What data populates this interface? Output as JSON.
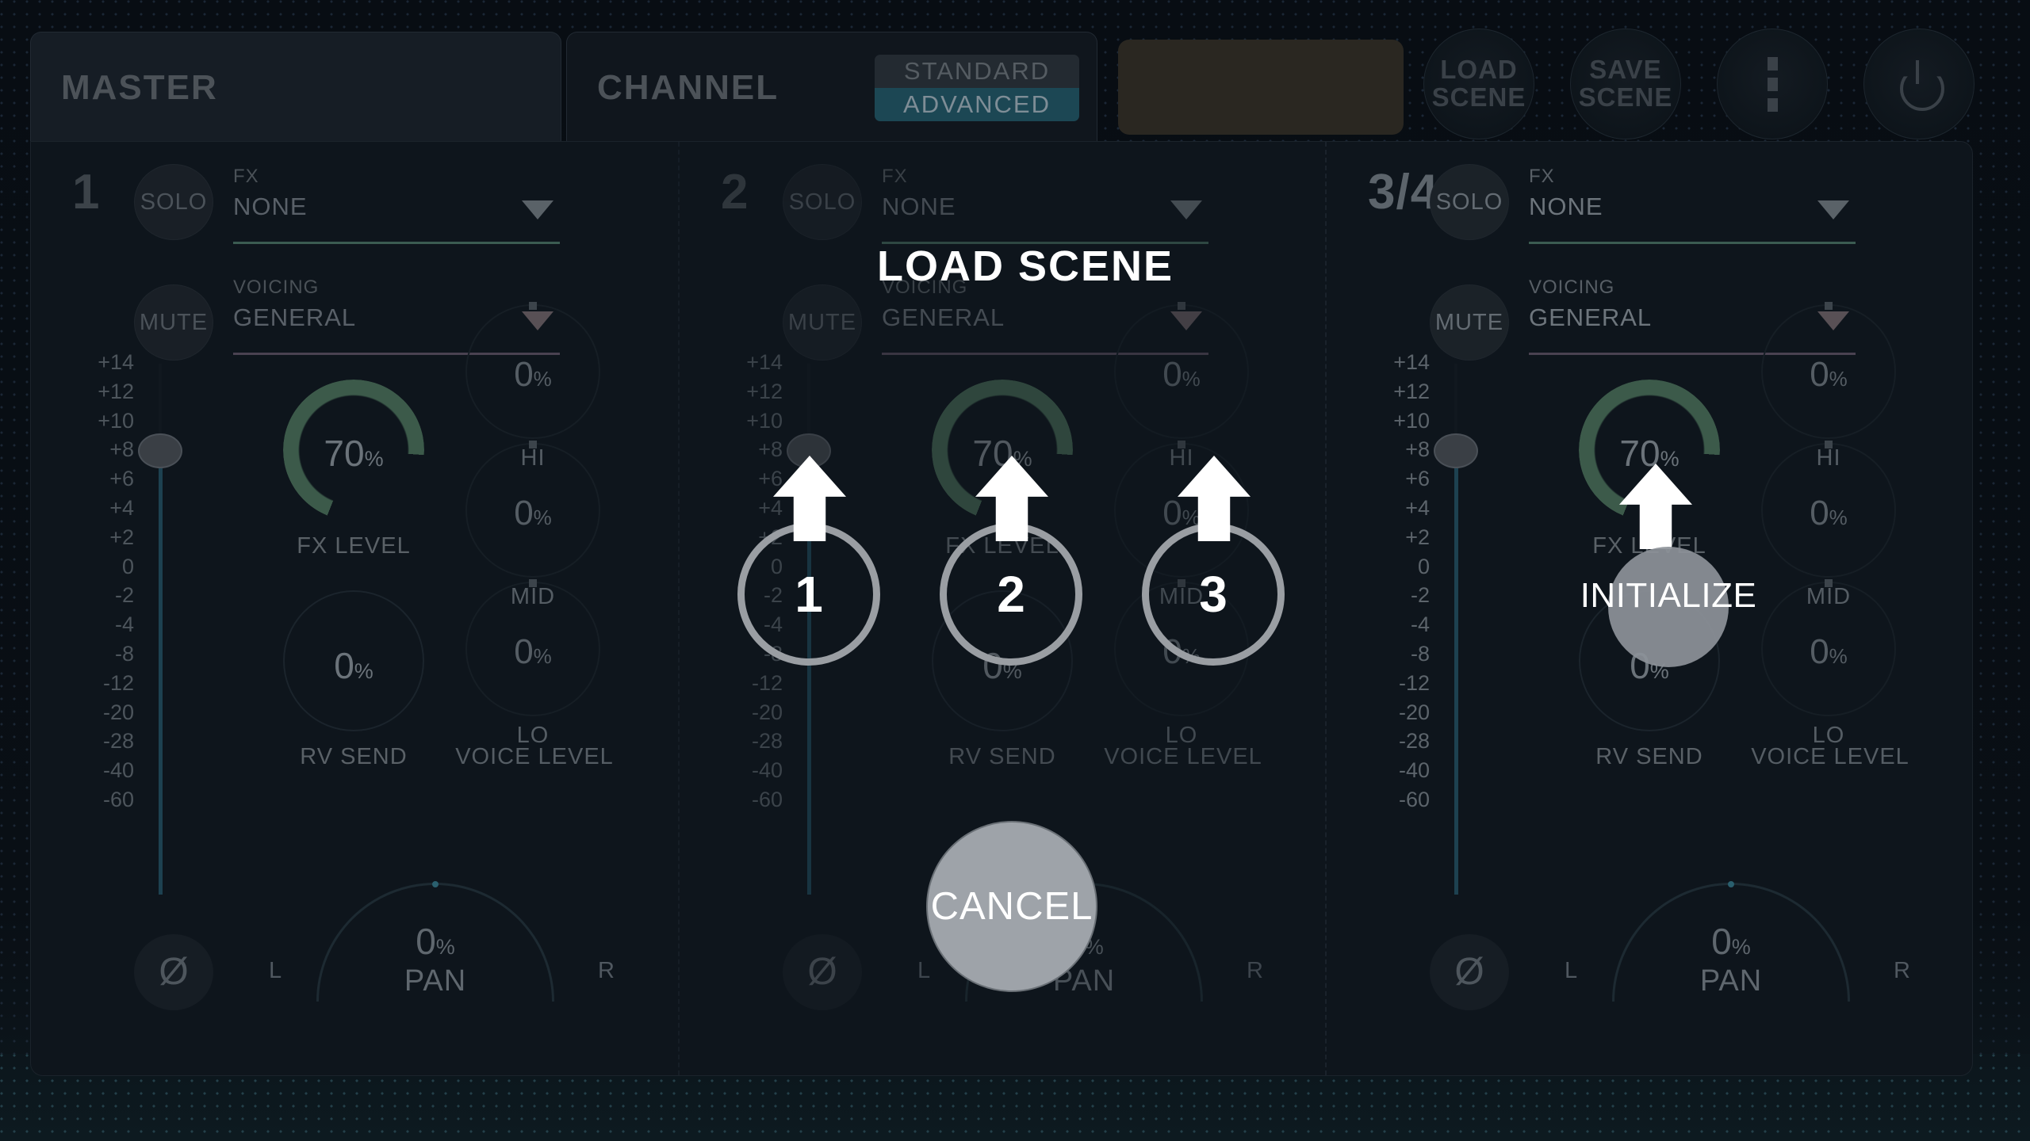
{
  "tabs": [
    {
      "label": "MASTER",
      "active": true
    },
    {
      "label": "CHANNEL",
      "active": false
    }
  ],
  "mode_switch": {
    "standard_label": "STANDARD",
    "advanced_label": "ADVANCED",
    "selected": "ADVANCED",
    "selected_color": "#1c4754"
  },
  "header_buttons": [
    {
      "name": "load-scene",
      "line1": "LOAD",
      "line2": "SCENE"
    },
    {
      "name": "save-scene",
      "line1": "SAVE",
      "line2": "SCENE"
    },
    {
      "name": "more-menu",
      "icon": "vertical-dots-icon"
    },
    {
      "name": "power",
      "icon": "power-icon"
    }
  ],
  "channels": [
    {
      "number": "1",
      "solo": "SOLO",
      "mute": "MUTE",
      "fx": {
        "caption": "FX",
        "value": "NONE"
      },
      "voicing": {
        "caption": "VOICING",
        "value": "GENERAL"
      },
      "fx_level": {
        "value": "70",
        "unit": "%",
        "label": "FX LEVEL"
      },
      "rv_send": {
        "value": "0",
        "unit": "%",
        "label": "RV SEND"
      },
      "eq": [
        {
          "value": "0",
          "unit": "%",
          "label": "HI"
        },
        {
          "value": "0",
          "unit": "%",
          "label": "MID"
        },
        {
          "value": "0",
          "unit": "%",
          "label": "LO"
        }
      ],
      "voice_level_label": "VOICE LEVEL",
      "phase_icon": "phase-invert-icon",
      "pan": {
        "value": "0",
        "unit": "%",
        "label": "PAN",
        "left": "L",
        "right": "R"
      }
    },
    {
      "number": "2",
      "solo": "SOLO",
      "mute": "MUTE",
      "fx": {
        "caption": "FX",
        "value": "NONE"
      },
      "voicing": {
        "caption": "VOICING",
        "value": "GENERAL"
      },
      "fx_level": {
        "value": "70",
        "unit": "%",
        "label": "FX LEVEL"
      },
      "rv_send": {
        "value": "0",
        "unit": "%",
        "label": "RV SEND"
      },
      "eq": [
        {
          "value": "0",
          "unit": "%",
          "label": "HI"
        },
        {
          "value": "0",
          "unit": "%",
          "label": "MID"
        },
        {
          "value": "0",
          "unit": "%",
          "label": "LO"
        }
      ],
      "voice_level_label": "VOICE LEVEL",
      "phase_icon": "phase-invert-icon",
      "pan": {
        "value": "0",
        "unit": "%",
        "label": "PAN",
        "left": "L",
        "right": "R"
      }
    },
    {
      "number": "3/4",
      "solo": "SOLO",
      "mute": "MUTE",
      "fx": {
        "caption": "FX",
        "value": "NONE"
      },
      "voicing": {
        "caption": "VOICING",
        "value": "GENERAL"
      },
      "fx_level": {
        "value": "70",
        "unit": "%",
        "label": "FX LEVEL"
      },
      "rv_send": {
        "value": "0",
        "unit": "%",
        "label": "RV SEND"
      },
      "eq": [
        {
          "value": "0",
          "unit": "%",
          "label": "HI"
        },
        {
          "value": "0",
          "unit": "%",
          "label": "MID"
        },
        {
          "value": "0",
          "unit": "%",
          "label": "LO"
        }
      ],
      "voice_level_label": "VOICE LEVEL",
      "phase_icon": "phase-invert-icon",
      "pan": {
        "value": "0",
        "unit": "%",
        "label": "PAN",
        "left": "L",
        "right": "R"
      }
    }
  ],
  "db_scale": [
    "+14",
    "+12",
    "+10",
    "+8",
    "+6",
    "+4",
    "+2",
    "0",
    "-2",
    "-4",
    "-8",
    "-12",
    "-20",
    "-28",
    "-40",
    "-60"
  ],
  "dialog": {
    "title": "LOAD SCENE",
    "slots": [
      {
        "label": "1",
        "arrow_icon": "up-arrow-icon"
      },
      {
        "label": "2",
        "arrow_icon": "up-arrow-icon"
      },
      {
        "label": "3",
        "arrow_icon": "up-arrow-icon"
      }
    ],
    "cancel_label": "CANCEL",
    "initialize_label": "INITIALIZE",
    "initialize_arrow_icon": "up-arrow-icon"
  },
  "colors": {
    "background": "#0b1118",
    "panel": "#0e151c",
    "accent_teal": "#1c4754",
    "fader_track": "#1d4150",
    "fx_arc_green": "#3c5a4a",
    "dialog_white": "#ffffff",
    "button_gray": "#9ea3a9"
  }
}
